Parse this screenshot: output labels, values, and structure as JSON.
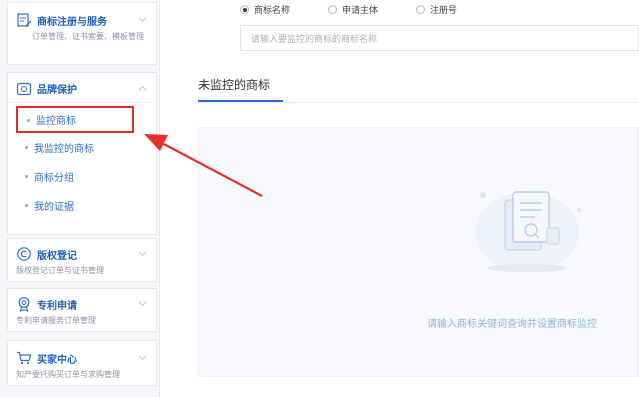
{
  "sidebar": {
    "trademark": {
      "title": "商标注册与服务",
      "desc": "订单管理、证书索要、模板管理"
    },
    "brand": {
      "title": "品牌保护",
      "items": [
        {
          "label": "监控商标"
        },
        {
          "label": "我监控的商标"
        },
        {
          "label": "商标分组"
        },
        {
          "label": "我的证据"
        }
      ]
    },
    "copyright": {
      "title": "版权登记",
      "desc": "版权登记订单与证书管理"
    },
    "patent": {
      "title": "专利申请",
      "desc": "专利申请服务订单管理"
    },
    "buyer": {
      "title": "买家中心",
      "desc": "知产委托购买订单与求购管理"
    }
  },
  "search": {
    "options": [
      "商标名称",
      "申请主体",
      "注册号"
    ],
    "selected": "商标名称",
    "placeholder": "请输入要监控的商标的商标名称"
  },
  "section": {
    "title": "未监控的商标"
  },
  "empty": {
    "text": "请输入商标关键词查询并设置商标监控"
  },
  "colors": {
    "accent": "#2f6fd0",
    "highlight": "#e02d2d"
  }
}
